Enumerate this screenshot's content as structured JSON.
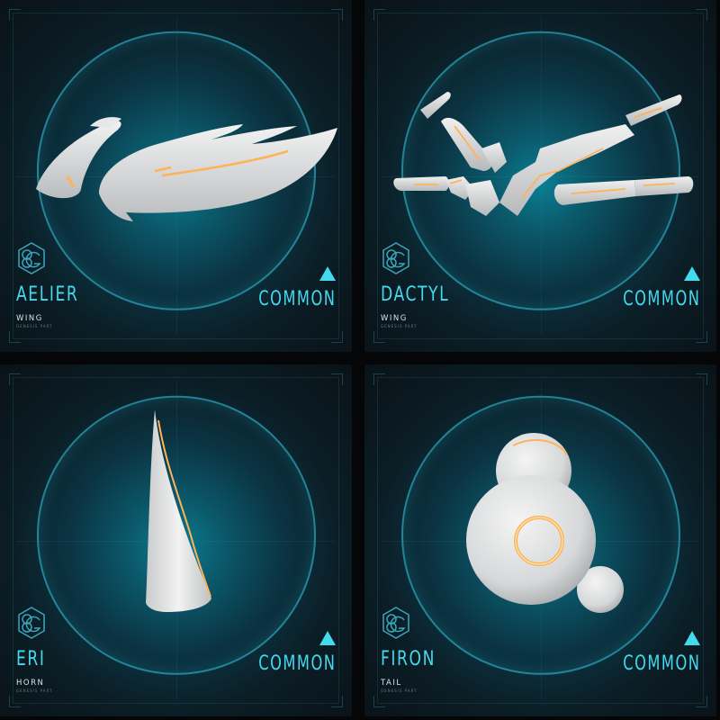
{
  "cards": [
    {
      "name": "AELIER",
      "type": "WING",
      "sub": "GENESIS PART",
      "rarity": "COMMON",
      "part_icon": "wing-part-icon"
    },
    {
      "name": "DACTYL",
      "type": "WING",
      "sub": "GENESIS PART",
      "rarity": "COMMON",
      "part_icon": "segmented-wing-part-icon"
    },
    {
      "name": "ERI",
      "type": "HORN",
      "sub": "GENESIS PART",
      "rarity": "COMMON",
      "part_icon": "horn-part-icon"
    },
    {
      "name": "FIRON",
      "type": "TAIL",
      "sub": "GENESIS PART",
      "rarity": "COMMON",
      "part_icon": "orb-tail-part-icon"
    }
  ],
  "colors": {
    "accent": "#43d9ef",
    "glow": "#f5a34a",
    "part": "#dcdcdc",
    "background": "#050607"
  },
  "rarity_icon": "triangle-up-icon",
  "brand_icon": "hex-g-logo-icon"
}
